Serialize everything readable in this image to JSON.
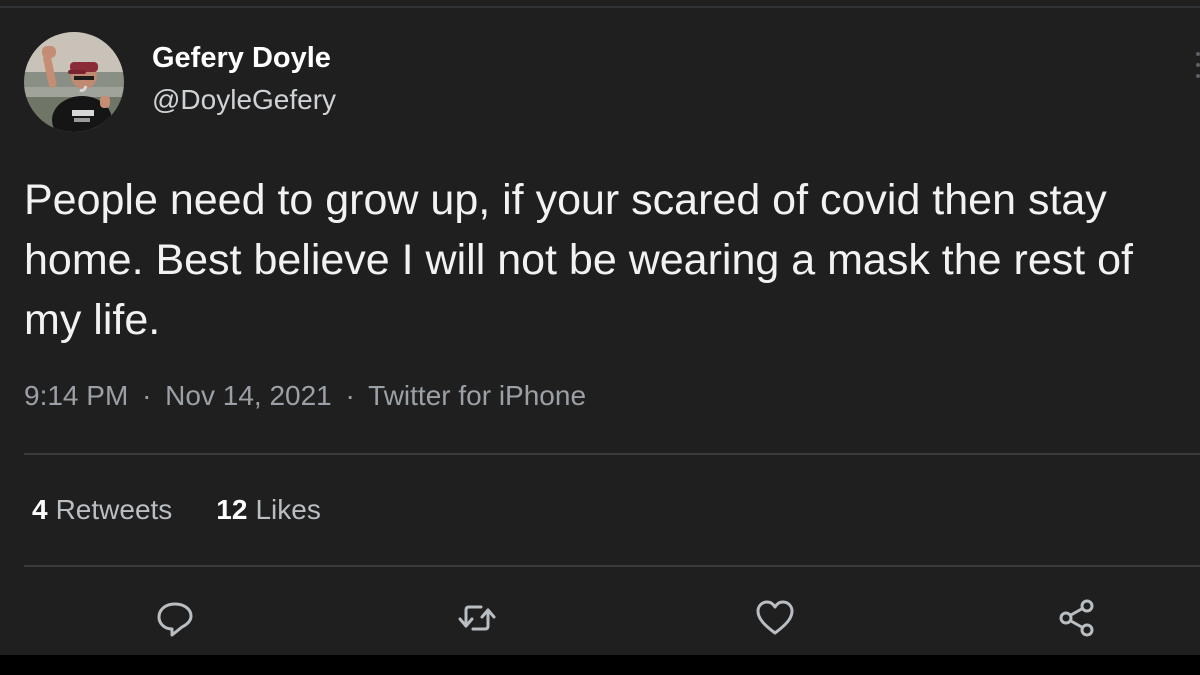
{
  "user": {
    "display_name": "Gefery Doyle",
    "handle": "@DoyleGefery",
    "avatar_icon": "profile-photo"
  },
  "tweet": {
    "text": "People need to grow up, if your scared of covid then stay home. Best believe I will not be wearing a mask the rest of my life.",
    "time": "9:14 PM",
    "date": "Nov 14, 2021",
    "source": "Twitter for iPhone",
    "separator": "·"
  },
  "stats": {
    "retweets_count": "4",
    "retweets_label": "Retweets",
    "likes_count": "12",
    "likes_label": "Likes"
  },
  "actions": {
    "reply_icon": "reply-icon",
    "retweet_icon": "retweet-icon",
    "like_icon": "heart-icon",
    "share_icon": "share-icon"
  },
  "colors": {
    "background": "#1f1f1f",
    "text_primary": "#f2f2f2",
    "text_secondary": "#9aa0a6",
    "divider": "#3a3d40"
  }
}
